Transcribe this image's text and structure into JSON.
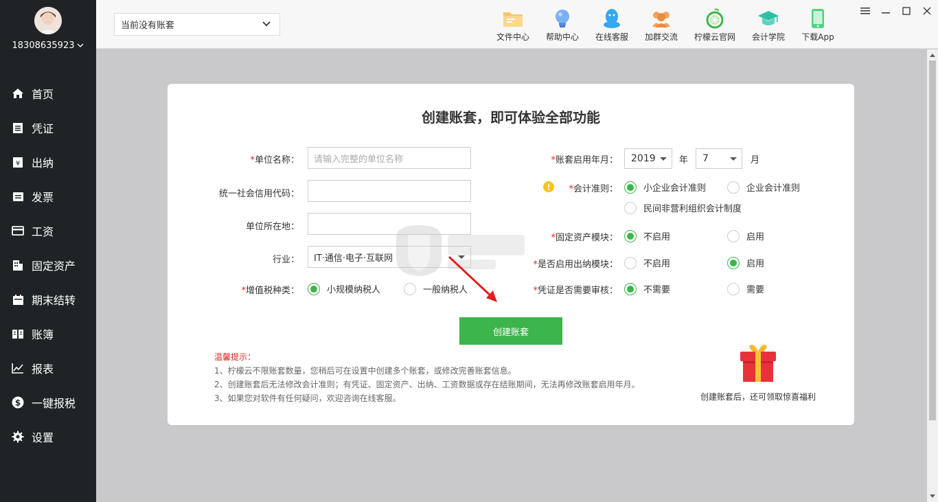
{
  "sidebar": {
    "username": "18308635923",
    "items": [
      {
        "label": "首页",
        "icon": "home-icon"
      },
      {
        "label": "凭证",
        "icon": "voucher-icon"
      },
      {
        "label": "出纳",
        "icon": "cashier-icon"
      },
      {
        "label": "发票",
        "icon": "invoice-icon"
      },
      {
        "label": "工资",
        "icon": "salary-icon"
      },
      {
        "label": "固定资产",
        "icon": "building-icon"
      },
      {
        "label": "期末结转",
        "icon": "calendar-icon"
      },
      {
        "label": "账簿",
        "icon": "book-icon"
      },
      {
        "label": "报表",
        "icon": "chart-icon"
      },
      {
        "label": "一键报税",
        "icon": "dollar-icon"
      },
      {
        "label": "设置",
        "icon": "gear-icon"
      }
    ]
  },
  "topbar": {
    "account_select": "当前没有账套",
    "tools": [
      {
        "label": "文件中心",
        "icon": "folder-icon"
      },
      {
        "label": "帮助中心",
        "icon": "lightbulb-icon"
      },
      {
        "label": "在线客服",
        "icon": "chat-icon"
      },
      {
        "label": "加群交流",
        "icon": "group-icon"
      },
      {
        "label": "柠檬云官网",
        "icon": "lemon-icon"
      },
      {
        "label": "会计学院",
        "icon": "graduation-cap-icon"
      },
      {
        "label": "下载App",
        "icon": "phone-icon"
      }
    ]
  },
  "form": {
    "title": "创建账套，即可体验全部功能",
    "company_name_label": "单位名称：",
    "company_name_placeholder": "请输入完整的单位名称",
    "credit_code_label": "统一社会信用代码：",
    "address_label": "单位所在地：",
    "industry_label": "行业：",
    "industry_value": "IT·通信·电子·互联网",
    "vat_label": "增值税种类：",
    "vat_options": [
      "小规模纳税人",
      "一般纳税人"
    ],
    "start_label": "账套启用年月：",
    "start_year": "2019",
    "year_unit": "年",
    "start_month": "7",
    "month_unit": "月",
    "standard_label": "会计准则：",
    "standard_options": [
      "小企业会计准则",
      "企业会计准则",
      "民间非营利组织会计制度"
    ],
    "asset_label": "固定资产模块：",
    "asset_options": [
      "不启用",
      "启用"
    ],
    "cashier_label": "是否启用出纳模块：",
    "cashier_options": [
      "不启用",
      "启用"
    ],
    "review_label": "凭证是否需要审核：",
    "review_options": [
      "不需要",
      "需要"
    ],
    "required_mark": "*",
    "create_button": "创建账套"
  },
  "tips": {
    "title": "温馨提示：",
    "lines": [
      "1、柠檬云不限账套数量，您稍后可在设置中创建多个账套，或修改完善账套信息。",
      "2、创建账套后无法修改会计准则；有凭证、固定资产、出纳、工资数据或存在结账期间，无法再修改账套启用年月。",
      "3、如果您对软件有任何疑问，欢迎咨询在线客服。"
    ]
  },
  "gift_text": "创建账套后，还可领取惊喜福利",
  "colors": {
    "accent": "#3cb54a",
    "sidebar": "#1f2325",
    "required": "#e1251b"
  }
}
